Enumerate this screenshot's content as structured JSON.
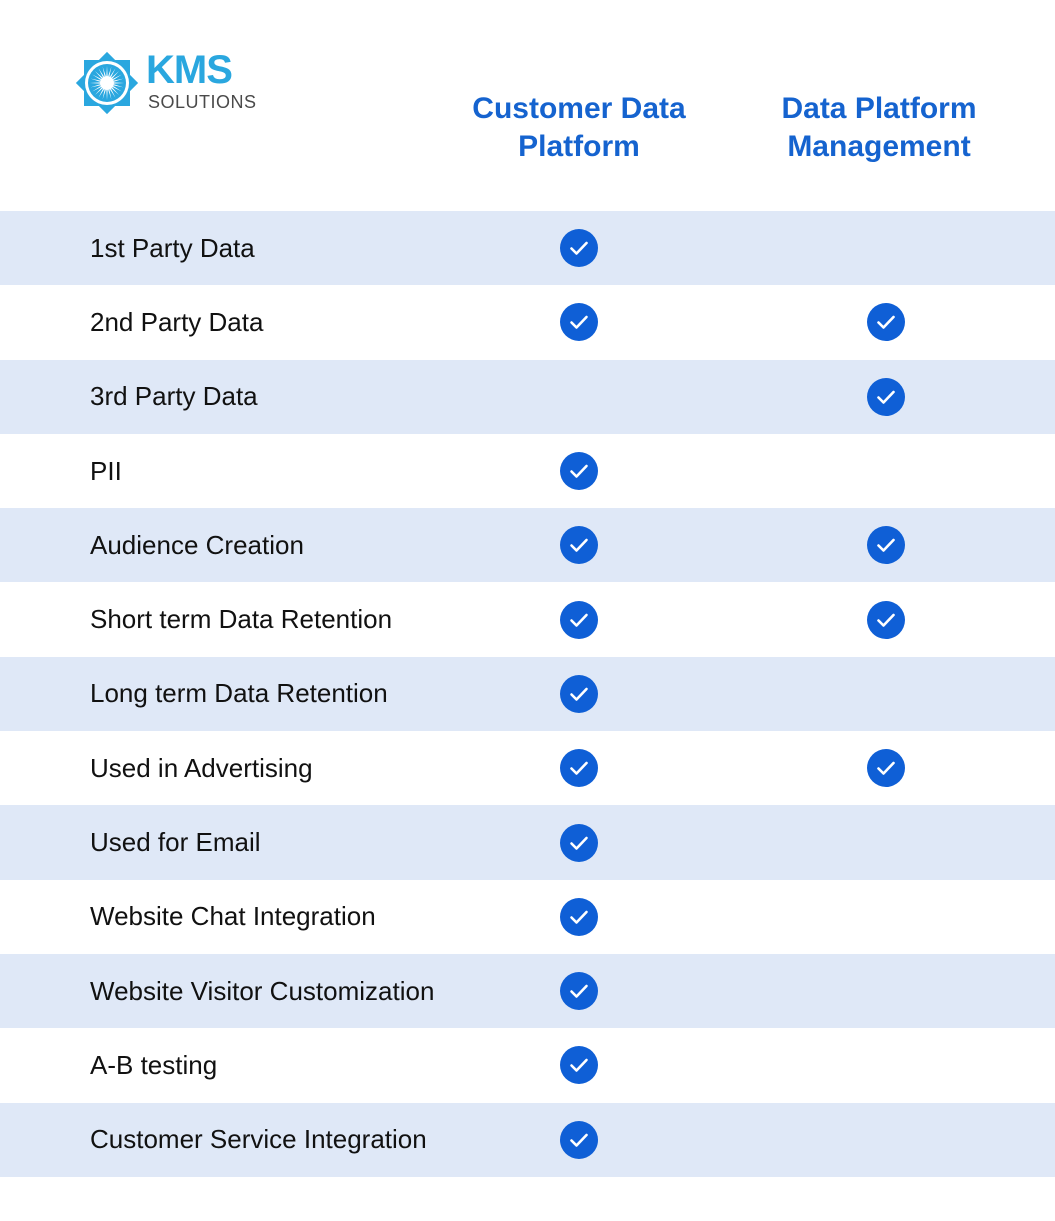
{
  "brand": {
    "name": "KMS",
    "subtitle": "SOLUTIONS",
    "primary_color": "#2aa7df"
  },
  "columns": [
    {
      "title": "Customer Data Platform",
      "line1": "Customer Data",
      "line2": "Platform"
    },
    {
      "title": "Data Platform Management",
      "line1": "Data Platform",
      "line2": "Management"
    }
  ],
  "colors": {
    "accent": "#1563cf",
    "check": "#0f5fd6",
    "band": "#dfe8f7"
  },
  "rows": [
    {
      "label": "1st Party Data",
      "cdp": true,
      "dmp": false
    },
    {
      "label": "2nd Party Data",
      "cdp": true,
      "dmp": true
    },
    {
      "label": "3rd Party Data",
      "cdp": false,
      "dmp": true
    },
    {
      "label": "PII",
      "cdp": true,
      "dmp": false
    },
    {
      "label": "Audience Creation",
      "cdp": true,
      "dmp": true
    },
    {
      "label": "Short term Data Retention",
      "cdp": true,
      "dmp": true
    },
    {
      "label": "Long term Data Retention",
      "cdp": true,
      "dmp": false
    },
    {
      "label": "Used in Advertising",
      "cdp": true,
      "dmp": true
    },
    {
      "label": "Used for Email",
      "cdp": true,
      "dmp": false
    },
    {
      "label": "Website Chat Integration",
      "cdp": true,
      "dmp": false
    },
    {
      "label": "Website Visitor Customization",
      "cdp": true,
      "dmp": false
    },
    {
      "label": "A-B testing",
      "cdp": true,
      "dmp": false
    },
    {
      "label": "Customer Service Integration",
      "cdp": true,
      "dmp": false
    }
  ],
  "icons": {
    "check": "check-circle-icon",
    "logo": "sunburst-emblem-icon"
  }
}
